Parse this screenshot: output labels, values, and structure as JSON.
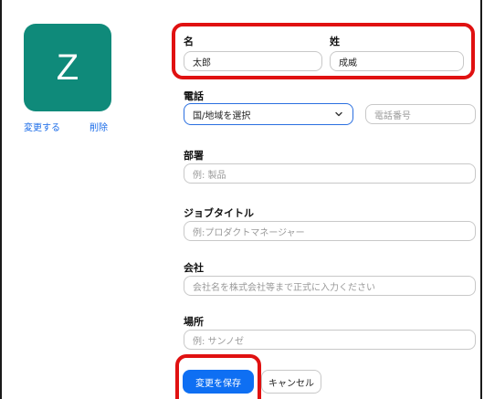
{
  "profile": {
    "avatar_initial": "Z",
    "change_label": "変更する",
    "delete_label": "削除"
  },
  "form": {
    "first_name": {
      "label": "名",
      "value": "太郎"
    },
    "last_name": {
      "label": "姓",
      "value": "成威"
    },
    "phone": {
      "label": "電話",
      "country_select": "国/地域を選択",
      "number_placeholder": "電話番号"
    },
    "department": {
      "label": "部署",
      "placeholder": "例: 製品"
    },
    "job_title": {
      "label": "ジョブタイトル",
      "placeholder": "例:プロダクトマネージャー"
    },
    "company": {
      "label": "会社",
      "placeholder": "会社名を株式会社等まで正式に入力ください"
    },
    "location": {
      "label": "場所",
      "placeholder": "例: サンノゼ"
    }
  },
  "actions": {
    "save": "変更を保存",
    "cancel": "キャンセル"
  },
  "colors": {
    "avatar_bg": "#0f8a7a",
    "primary": "#0e6ff3",
    "highlight": "#e01111",
    "link": "#1b6ce8"
  }
}
